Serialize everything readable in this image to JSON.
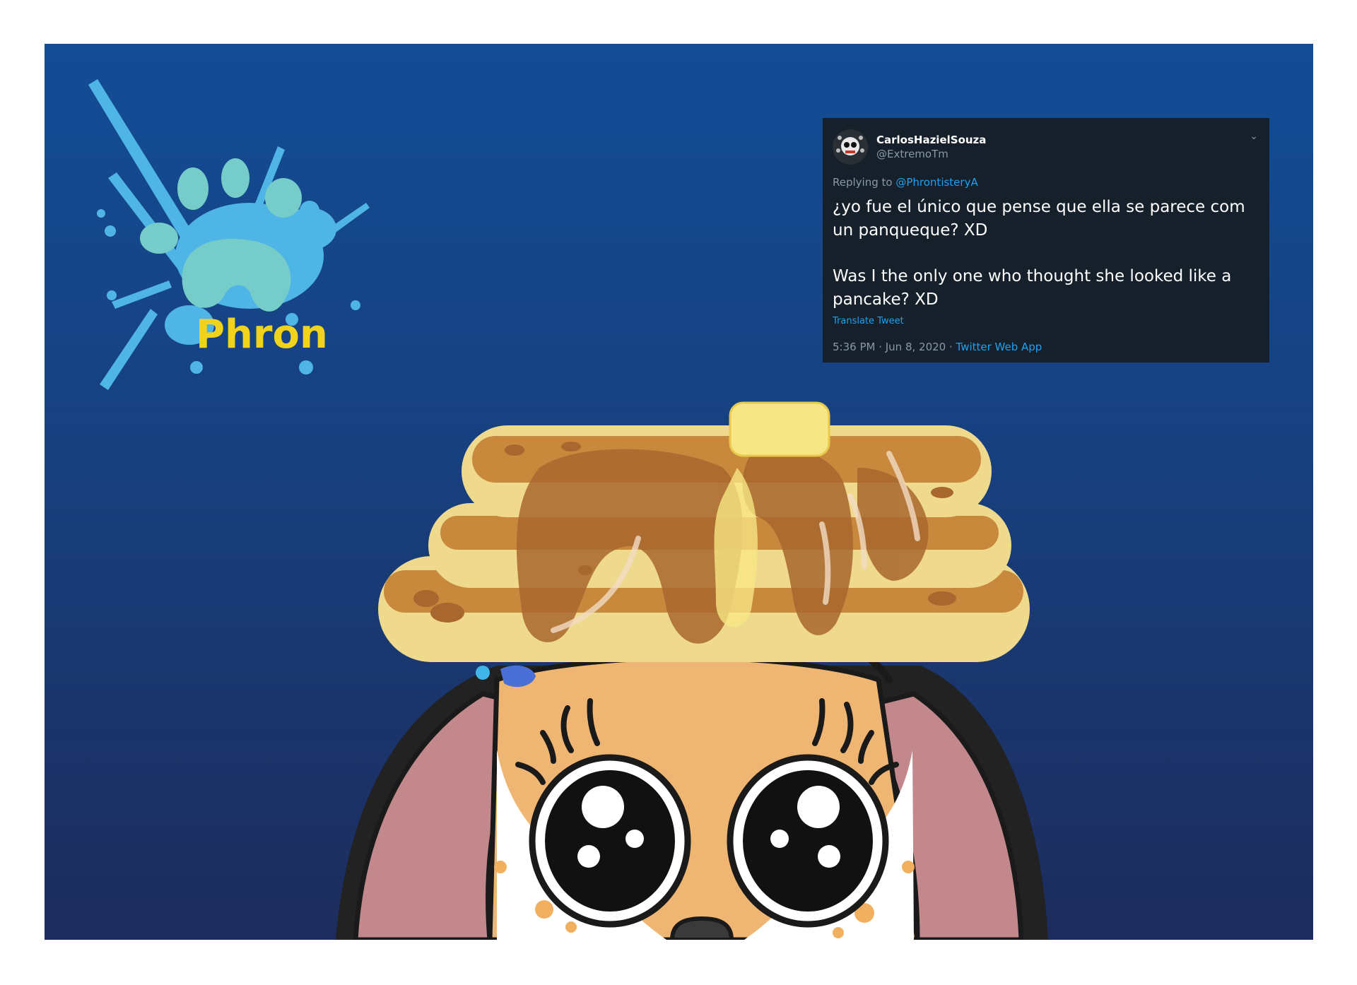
{
  "logo": {
    "text": "Phron"
  },
  "tweet": {
    "display_name": "CarlosHazielSouza",
    "handle": "@ExtremoTm",
    "replying_to_prefix": "Replying to",
    "replying_to_handle": "@PhrontisteryA",
    "text_es": "¿yo fue el único que pense que ella se parece com un panqueque? XD",
    "text_en": "Was I the only one who thought she looked like a pancake? XD",
    "translate_label": "Translate Tweet",
    "timestamp": "5:36 PM · Jun 8, 2020 · ",
    "app": "Twitter Web App",
    "menu_icon": "chevron-down-icon"
  },
  "colors": {
    "background_top": "#134d96",
    "background_bottom": "#1d2c5c",
    "tweet_bg": "#15202b",
    "link": "#1da1f2",
    "logo_splash": "#4fb4e6",
    "logo_paw": "#76ccc8",
    "logo_text": "#f2d31b",
    "pancake": "#eed98c",
    "syrup": "#a8672e",
    "butter": "#f7e685",
    "skin": "#efb573",
    "hair": "#c2888c"
  }
}
